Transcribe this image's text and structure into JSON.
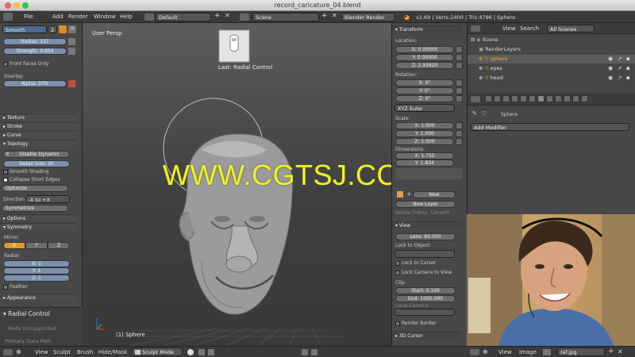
{
  "window": {
    "title": "record_caricature_04.blend"
  },
  "menubar": {
    "items": [
      "File",
      "Add",
      "Render",
      "Window",
      "Help"
    ],
    "layout": "Default",
    "scene": "Scene",
    "engine": "Blender Render",
    "stats": "v2.69 | Verts:2400 | Tris:4796 | Sphere"
  },
  "left": {
    "brush": "Smooth",
    "brush_count": "2",
    "radius": "Radius: 127",
    "strength": "Strength: 0.854",
    "front_faces": "Front Faces Only",
    "overlay": "Overlay:",
    "alpha": "Alpha: 33%",
    "texture": "Texture",
    "stroke": "Stroke",
    "curve": "Curve",
    "topology": "Topology",
    "disable_dynamic": "Disable Dynamic",
    "detail_size": "Detail Size: 30",
    "smooth_shading": "Smooth Shading",
    "collapse_edges": "Collapse Short Edges",
    "optimize": "Optimize",
    "direction_label": "Direction:",
    "direction_value": "-X to +X",
    "symmetrize": "Symmetrize",
    "options": "Options",
    "symmetry": "Symmetry",
    "mirror": "Mirror:",
    "mx": "X",
    "my": "Y",
    "mz": "Z",
    "radial": "Radial:",
    "rx": "X: 1",
    "ry": "Y: 1",
    "rz": "Z: 1",
    "feather": "Feather",
    "appearance": "Appearance",
    "radial_control": "Radial Control",
    "redo": "Redo Unsupported",
    "primary": "Primary Data Path"
  },
  "view3d": {
    "label": "User Persp",
    "last_op": "Last: Radial Control",
    "object_label": "(1) Sphere",
    "watermark": "WWW.CGTSJ.COM"
  },
  "transform": {
    "title": "Transform",
    "location": "Location:",
    "lx": "X: 0.00000",
    "ly": "Y: 0.00000",
    "lz": "Z: 2.93820",
    "rotation": "Rotation:",
    "rx": "X: 0°",
    "ry": "Y: 0°",
    "rz": "Z: 0°",
    "rot_mode": "XYZ Euler",
    "scale": "Scale:",
    "sx": "X: 1.000",
    "sy": "Y: 1.000",
    "sz": "Z: 1.000",
    "dimensions": "Dimensions:",
    "dx": "X: 1.755",
    "dy": "Y: 1.834",
    "new_btn": "New",
    "new_layer": "New Layer",
    "delete_frame": "Delete Frame",
    "convert": "Convert"
  },
  "viewpanel": {
    "title": "View",
    "lens": "Lens: 60.000",
    "lock_object": "Lock to Object:",
    "lock_cursor": "Lock to Cursor",
    "lock_camera": "Lock Camera to View",
    "clip": "Clip:",
    "clip_start": "Start: 0.100",
    "clip_end": "End: 1000.000",
    "local_camera": "Local Camera:",
    "render_border": "Render Border",
    "cursor": "3D Cursor"
  },
  "outliner": {
    "view": "View",
    "search": "Search",
    "scope": "All Scenes",
    "items": [
      {
        "label": "Scene",
        "depth": 0
      },
      {
        "label": "RenderLayers",
        "depth": 1
      },
      {
        "label": "sphere",
        "depth": 1
      },
      {
        "label": "eyes",
        "depth": 1
      },
      {
        "label": "head",
        "depth": 1
      }
    ]
  },
  "props": {
    "object": "Sphere",
    "add_modifier": "Add Modifier"
  },
  "bottombar": {
    "items": [
      "View",
      "Sculpt",
      "Brush",
      "Hide/Mask"
    ],
    "mode": "Sculpt Mode",
    "right_items": [
      "View",
      "Image"
    ],
    "image": "ref.jpg"
  },
  "colors": {
    "accent": "#f7a42c",
    "watermark": "#f2f21c"
  }
}
